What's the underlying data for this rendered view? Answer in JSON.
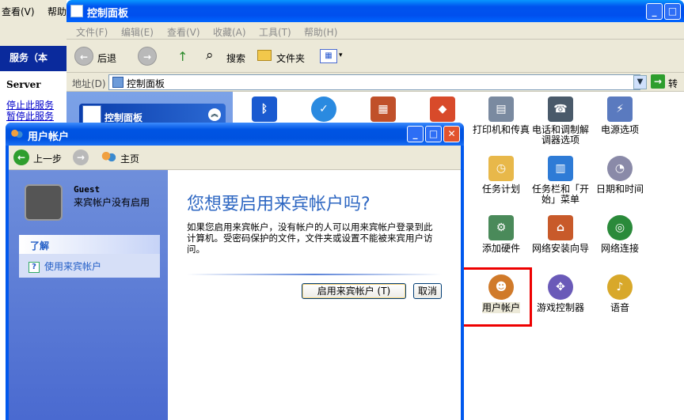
{
  "services_window": {
    "menu": [
      "查看(V)",
      "帮助"
    ],
    "header_title": "服务（本",
    "server_label": "Server",
    "links": [
      "停止此服务",
      "暂停此服务"
    ]
  },
  "control_panel": {
    "title": "控制面板",
    "menu": [
      "文件(F)",
      "编辑(E)",
      "查看(V)",
      "收藏(A)",
      "工具(T)",
      "帮助(H)"
    ],
    "toolbar": {
      "back": "后退",
      "search": "搜索",
      "folders": "文件夹"
    },
    "address": {
      "label": "地址(D)",
      "value": "控制面板",
      "go": "转到"
    },
    "left_panel_title": "控制面板",
    "icons": [
      {
        "label": "打印机和传真",
        "icon": "printer-icon",
        "color": "#7a8aa0"
      },
      {
        "label": "电话和调制解调器选项",
        "icon": "phone-modem-icon",
        "color": "#4a5a6a"
      },
      {
        "label": "电源选项",
        "icon": "power-icon",
        "color": "#5a7abf"
      },
      {
        "label": "任务计划",
        "icon": "scheduled-tasks-icon",
        "color": "#e8b84a"
      },
      {
        "label": "任务栏和「开始」菜单",
        "icon": "taskbar-icon",
        "color": "#2e7bd6"
      },
      {
        "label": "日期和时间",
        "icon": "clock-icon",
        "color": "#8a8aa8"
      },
      {
        "label": "添加硬件",
        "icon": "add-hardware-icon",
        "color": "#4a8a5a"
      },
      {
        "label": "网络安装向导",
        "icon": "network-wizard-icon",
        "color": "#c85a2a"
      },
      {
        "label": "网络连接",
        "icon": "network-connections-icon",
        "color": "#2a8a3a"
      },
      {
        "label": "用户帐户",
        "icon": "user-accounts-icon",
        "color": "#d07a2a"
      },
      {
        "label": "游戏控制器",
        "icon": "game-controller-icon",
        "color": "#6a5ab8"
      },
      {
        "label": "语音",
        "icon": "speech-icon",
        "color": "#d8a82a"
      }
    ],
    "top_icons": [
      {
        "icon": "bluetooth-icon",
        "color": "#1a5ad0"
      },
      {
        "icon": "accessibility-icon",
        "color": "#2a8ae0"
      },
      {
        "icon": "firewall-icon",
        "color": "#c0502a"
      },
      {
        "icon": "security-center-icon",
        "color": "#d84a2a"
      }
    ]
  },
  "user_accounts_dialog": {
    "title": "用户帐户",
    "nav": {
      "back": "上一步",
      "home": "主页"
    },
    "account": {
      "name": "Guest",
      "status": "来宾帐户没有启用"
    },
    "learn_header": "了解",
    "learn_link": "使用来宾帐户",
    "heading": "您想要启用来宾帐户吗?",
    "description": "如果您启用来宾帐户，没有帐户的人可以用来宾帐户登录到此计算机。受密码保护的文件，文件夹或设置不能被来宾用户访问。",
    "enable_button": "启用来宾帐户 (T)",
    "cancel_button": "取消"
  }
}
